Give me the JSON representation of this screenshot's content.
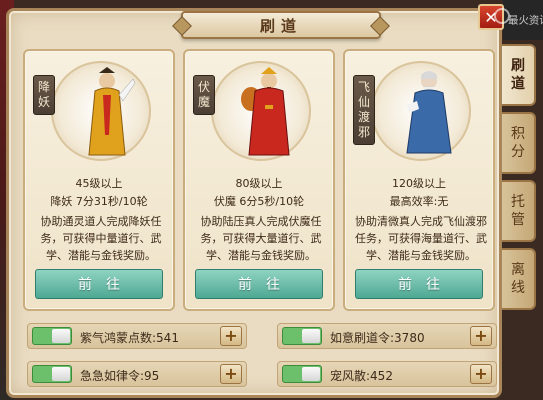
{
  "window": {
    "title": "刷道",
    "close_label": "✕"
  },
  "watermark": "最火资讯",
  "tabs": [
    {
      "label": [
        "刷",
        "道"
      ],
      "active": true
    },
    {
      "label": [
        "积",
        "分"
      ],
      "active": false
    },
    {
      "label": [
        "托",
        "管"
      ],
      "active": false
    },
    {
      "label": [
        "离",
        "线"
      ],
      "active": false
    }
  ],
  "cards": [
    {
      "badge": [
        "降",
        "妖"
      ],
      "level": "45级以上",
      "time": "降妖 7分31秒/10轮",
      "desc": "协助通灵道人完成降妖任务，可获得中量道行、武学、潜能与金钱奖励。",
      "button": "前往",
      "robe_color": "#e0a21c"
    },
    {
      "badge": [
        "伏",
        "魔"
      ],
      "level": "80级以上",
      "time": "伏魔 6分5秒/10轮",
      "desc": "协助陆压真人完成伏魔任务，可获得大量道行、武学、潜能与金钱奖励。",
      "button": "前往",
      "robe_color": "#c8281e"
    },
    {
      "badge": [
        "飞",
        "仙",
        "渡",
        "邪"
      ],
      "level": "120级以上",
      "time": "最高效率:无",
      "desc": "协助清微真人完成飞仙渡邪任务，可获得海量道行、武学、潜能与金钱奖励。",
      "button": "前往",
      "robe_color": "#3a6aa8"
    }
  ],
  "options": [
    {
      "label": "紫气鸿蒙点数:541",
      "on": true
    },
    {
      "label": "如意刷道令:3780",
      "on": true
    },
    {
      "label": "急急如律令:95",
      "on": true
    },
    {
      "label": "宠风散:452",
      "on": true
    }
  ],
  "colors": {
    "accent": "#4ea893",
    "panel": "#e9dcc2",
    "close": "#a21d12"
  }
}
